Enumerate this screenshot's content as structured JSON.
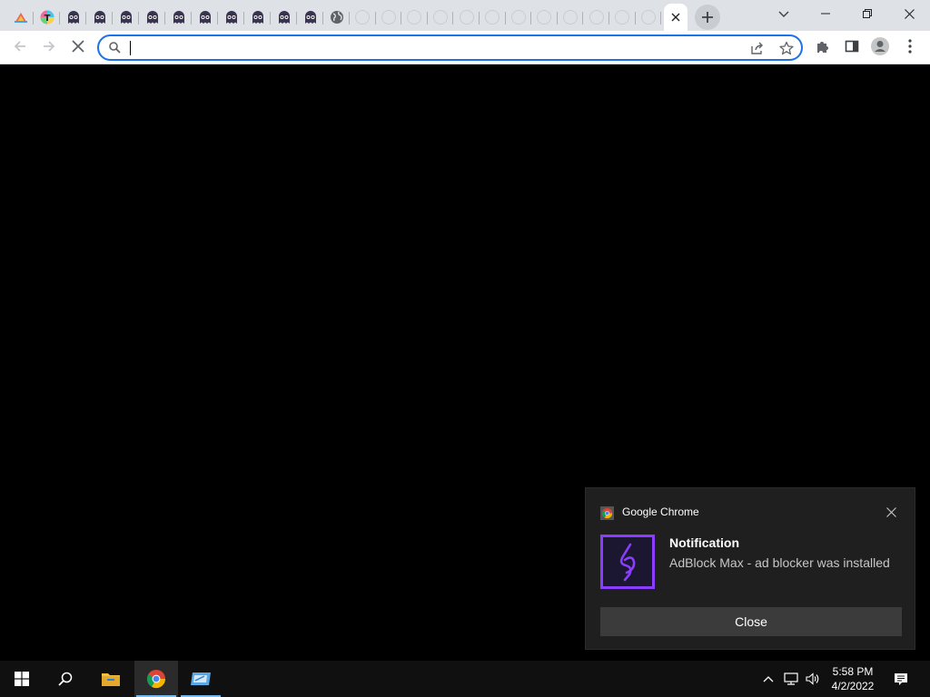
{
  "browser": {
    "tabs": [
      {
        "icon": "rainbow-hat-icon"
      },
      {
        "icon": "t-logo-icon"
      },
      {
        "icon": "ghost-icon"
      },
      {
        "icon": "ghost-icon"
      },
      {
        "icon": "ghost-icon"
      },
      {
        "icon": "ghost-icon"
      },
      {
        "icon": "ghost-icon"
      },
      {
        "icon": "ghost-icon"
      },
      {
        "icon": "ghost-icon"
      },
      {
        "icon": "ghost-icon"
      },
      {
        "icon": "ghost-icon"
      },
      {
        "icon": "ghost-icon"
      },
      {
        "icon": "globe-icon"
      },
      {
        "icon": "blank-tab-icon"
      },
      {
        "icon": "blank-tab-icon"
      },
      {
        "icon": "blank-tab-icon"
      },
      {
        "icon": "blank-tab-icon"
      },
      {
        "icon": "blank-tab-icon"
      },
      {
        "icon": "blank-tab-icon"
      },
      {
        "icon": "blank-tab-icon"
      },
      {
        "icon": "blank-tab-icon"
      },
      {
        "icon": "blank-tab-icon"
      },
      {
        "icon": "blank-tab-icon"
      },
      {
        "icon": "blank-tab-icon"
      },
      {
        "icon": "blank-tab-icon"
      }
    ],
    "omnibox": {
      "value": "",
      "placeholder": ""
    },
    "accent": "#1a73e8"
  },
  "notification": {
    "app_name": "Google Chrome",
    "title": "Notification",
    "message": "AdBlock Max - ad blocker was installed",
    "close_label": "Close",
    "brand_color": "#8a3cff"
  },
  "taskbar": {
    "time": "5:58 PM",
    "date": "4/2/2022"
  }
}
